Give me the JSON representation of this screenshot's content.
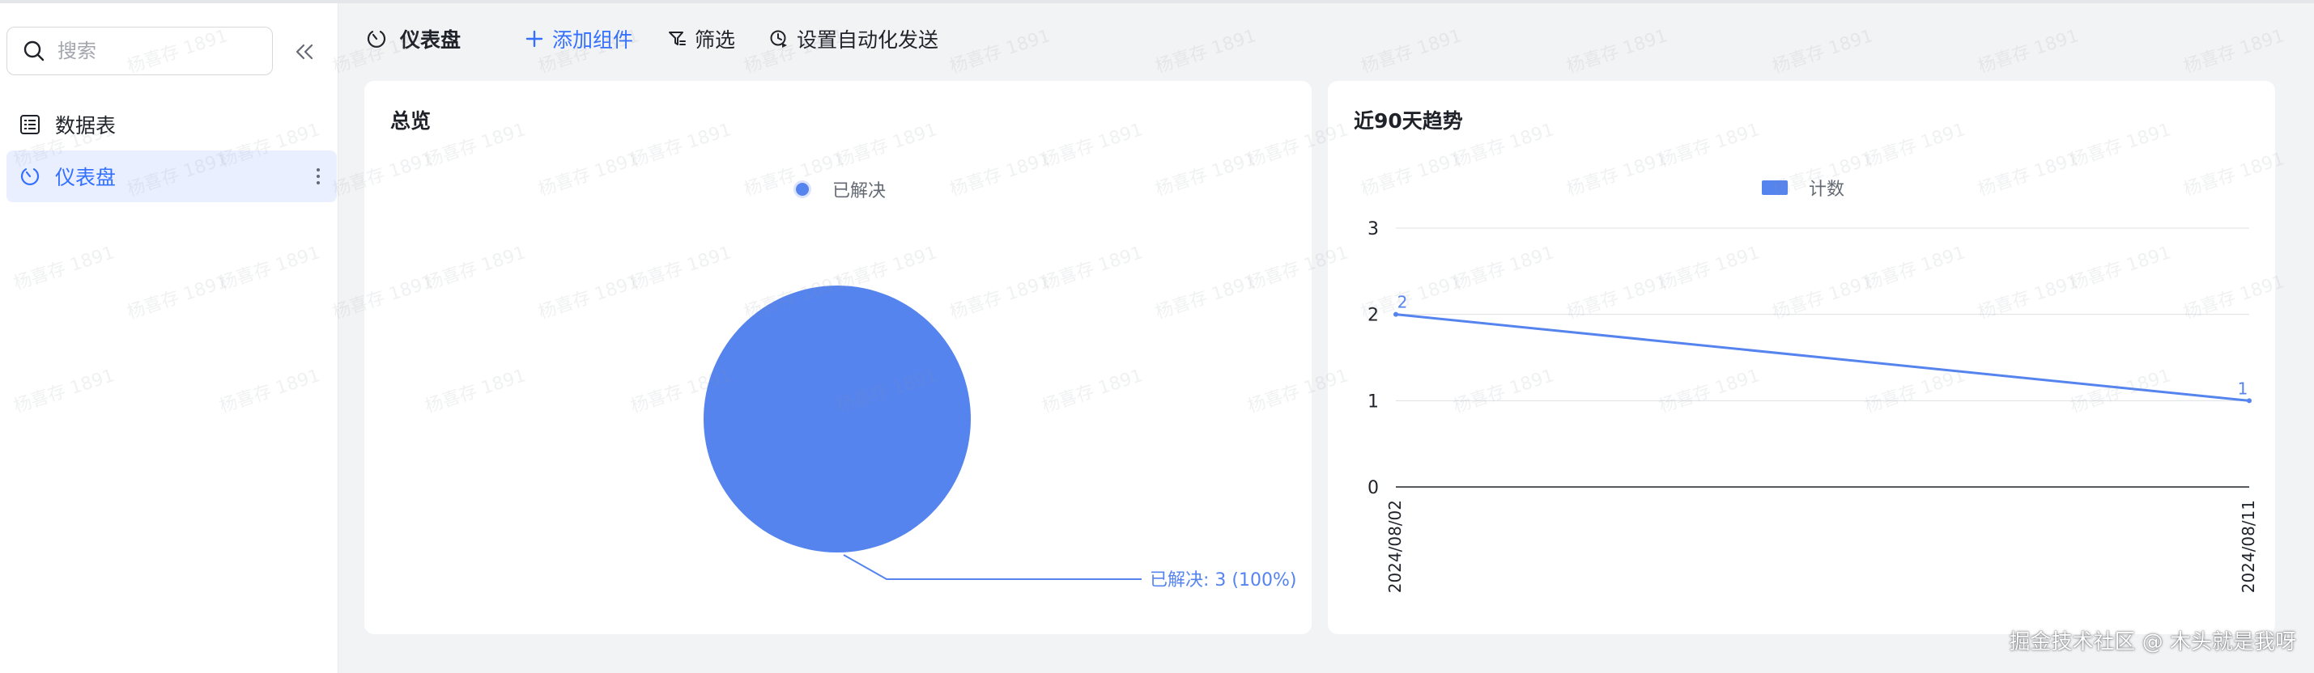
{
  "sidebar": {
    "search_placeholder": "搜索",
    "items": [
      {
        "label": "数据表",
        "icon": "table-icon",
        "active": false
      },
      {
        "label": "仪表盘",
        "icon": "dashboard-icon",
        "active": true
      }
    ]
  },
  "toolbar": {
    "title": "仪表盘",
    "add_label": "添加组件",
    "filter_label": "筛选",
    "automation_label": "设置自动化发送"
  },
  "overview": {
    "title": "总览",
    "legend": "已解决",
    "slice_label": "已解决: 3 (100%)"
  },
  "trend": {
    "title": "近90天趋势",
    "legend": "计数"
  },
  "chart_data": [
    {
      "type": "pie",
      "categories": [
        "已解决"
      ],
      "values": [
        3
      ],
      "title": "总览",
      "color": "#5584ef"
    },
    {
      "type": "line",
      "x": [
        "2024/08/02",
        "2024/08/11"
      ],
      "series": [
        {
          "name": "计数",
          "values": [
            2,
            1
          ]
        }
      ],
      "title": "近90天趋势",
      "ylim": [
        0,
        3
      ],
      "yticks": [
        0,
        1,
        2,
        3
      ],
      "grid": true,
      "legend": "top-center",
      "color": "#5584ef"
    }
  ],
  "colors": {
    "accent": "#3370ff",
    "series": "#5584ef",
    "active_bg": "#e9efff"
  },
  "watermark": "杨喜存 1891",
  "footer_watermark": "掘金技术社区 @ 木头就是我呀"
}
